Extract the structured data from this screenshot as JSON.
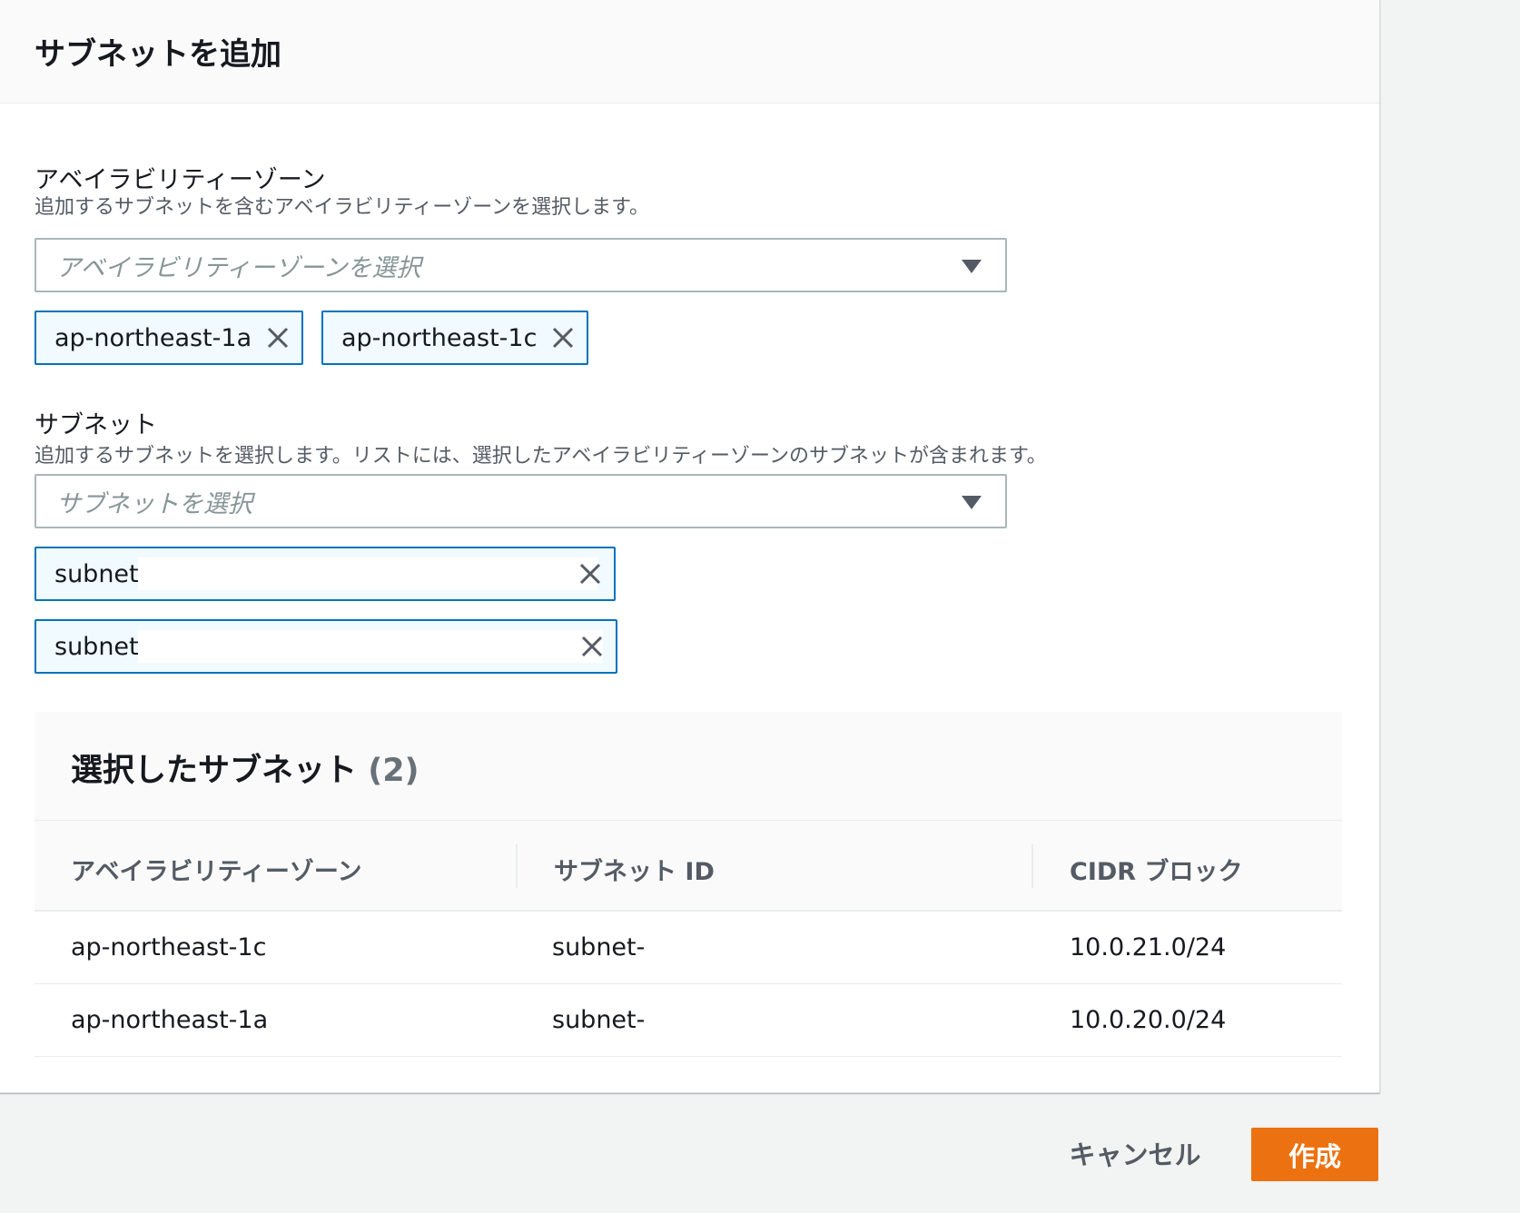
{
  "modal": {
    "title": "サブネットを追加"
  },
  "az_field": {
    "label": "アベイラビリティーゾーン",
    "description": "追加するサブネットを含むアベイラビリティーゾーンを選択します。",
    "placeholder": "アベイラビリティーゾーンを選択",
    "tokens": [
      "ap-northeast-1a",
      "ap-northeast-1c"
    ]
  },
  "subnet_field": {
    "label": "サブネット",
    "description": "追加するサブネットを選択します。リストには、選択したアベイラビリティーゾーンのサブネットが含まれます。",
    "placeholder": "サブネットを選択",
    "tokens": [
      "subnet-",
      "subnet-"
    ]
  },
  "selected_panel": {
    "title": "選択したサブネット",
    "count": "(2)",
    "columns": [
      "アベイラビリティーゾーン",
      "サブネット ID",
      "CIDR ブロック"
    ],
    "rows": [
      [
        "ap-northeast-1c",
        "subnet-",
        "10.0.21.0/24"
      ],
      [
        "ap-northeast-1a",
        "subnet-",
        "10.0.20.0/24"
      ]
    ]
  },
  "footer": {
    "cancel_label": "キャンセル",
    "create_label": "作成"
  },
  "colors": {
    "primary_button": "#ec7211",
    "token_border": "#0073bb",
    "token_bg": "#f1faff"
  }
}
